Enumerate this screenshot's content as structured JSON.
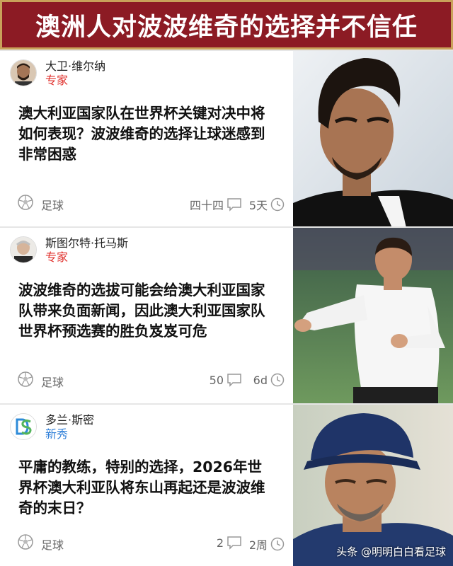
{
  "banner": {
    "title": "澳洲人对波波维奇的选择并不信任"
  },
  "cards": [
    {
      "author": "大卫·维尔纳",
      "tag": "专家",
      "headline": "澳大利亚国家队在世界杯关键对决中将如何表现？波波维奇的选择让球迷感到非常困惑",
      "topic": "足球",
      "comments": "四十四",
      "time": "5天"
    },
    {
      "author": "斯图尔特·托马斯",
      "tag": "专家",
      "headline": "波波维奇的选拔可能会给澳大利亚国家队带来负面新闻，因此澳大利亚国家队世界杯预选赛的胜负岌岌可危",
      "topic": "足球",
      "comments": "50",
      "time": "6d"
    },
    {
      "author": "多兰·斯密",
      "tag": "新秀",
      "headline": "平庸的教练，特别的选择，2026年世界杯澳大利亚队将东山再起还是波波维奇的末日？",
      "topic": "足球",
      "comments": "2",
      "time": "2周"
    }
  ],
  "watermark": "头条 @明明白白看足球",
  "colors": {
    "banner_bg": "#8c1b24",
    "banner_border": "#c9a25a",
    "tag_expert": "#e0302c",
    "tag_rookie": "#2f7fd8"
  },
  "icons": [
    "soccer-ball-icon",
    "comment-bubble-icon",
    "clock-icon"
  ]
}
